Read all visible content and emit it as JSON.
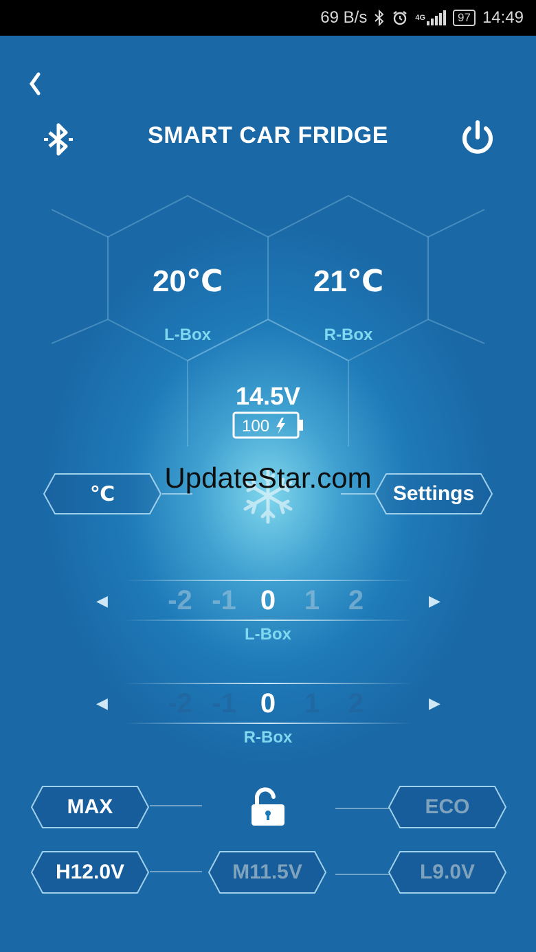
{
  "status_bar": {
    "net_speed": "69 B/s",
    "network": "4G",
    "battery": "97",
    "time": "14:49",
    "icons": [
      "bluetooth-icon",
      "alarm-icon",
      "signal-icon",
      "battery-icon"
    ]
  },
  "header": {
    "back_icon": "back-chevron-icon",
    "bluetooth_icon": "bluetooth-icon",
    "title": "SMART CAR FRIDGE",
    "power_icon": "power-icon"
  },
  "boxes": {
    "left": {
      "temp": "20℃",
      "label": "L-Box"
    },
    "right": {
      "temp": "21℃",
      "label": "R-Box"
    }
  },
  "power": {
    "voltage": "14.5V",
    "battery_level": "100"
  },
  "controls": {
    "unit_label": "℃",
    "settings_label": "Settings",
    "snowflake_icon": "snowflake-icon"
  },
  "pickers": {
    "left": {
      "values": [
        "-2",
        "-1",
        "0",
        "1",
        "2"
      ],
      "selected": "0",
      "label": "L-Box"
    },
    "right": {
      "values": [
        "-2",
        "-1",
        "0",
        "1",
        "2"
      ],
      "selected": "0",
      "label": "R-Box"
    }
  },
  "modes": {
    "max_label": "MAX",
    "eco_label": "ECO",
    "lock_icon": "unlock-icon"
  },
  "voltage_protection": {
    "high": "H12.0V",
    "medium": "M11.5V",
    "low": "L9.0V"
  },
  "watermark": "UpdateStar.com",
  "colors": {
    "background": "#1f7ab8",
    "glow": "#7fd6ec",
    "label_cyan": "#7fd8f0",
    "line": "#8cc6e6"
  }
}
